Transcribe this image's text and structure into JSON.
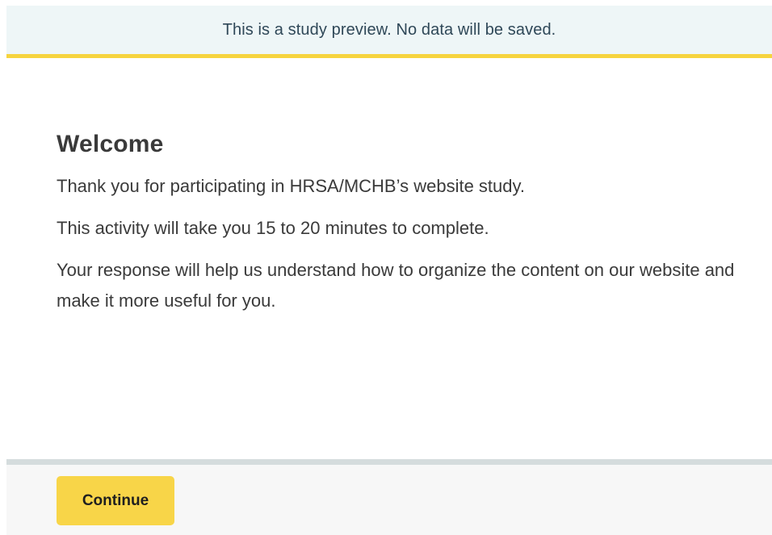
{
  "banner": {
    "text": "This is a study preview. No data will be saved."
  },
  "main": {
    "title": "Welcome",
    "paragraphs": [
      "Thank you for participating in HRSA/MCHB’s website study.",
      "This activity will take you 15 to 20 minutes to complete.",
      "Your response will help us understand how to organize the content on our website and make it more useful for you."
    ]
  },
  "footer": {
    "continue_label": "Continue"
  },
  "colors": {
    "banner_bg": "#eef6f7",
    "banner_accent": "#f6d43f",
    "button_bg": "#f8d548",
    "footer_bg": "#f7f7f7",
    "footer_border": "#d5dcdd"
  }
}
